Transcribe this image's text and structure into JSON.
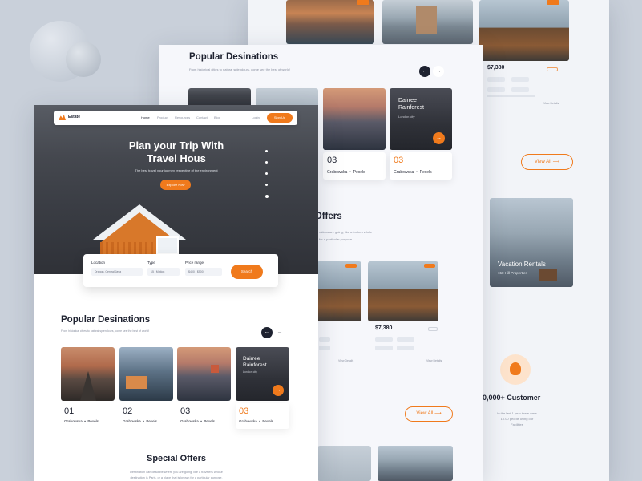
{
  "brand": {
    "name": "Estate"
  },
  "nav": {
    "items": [
      "Home",
      "Product",
      "Resources",
      "Contact",
      "Blog"
    ],
    "login": "Login",
    "signup": "Sign Up"
  },
  "hero": {
    "title_line1": "Plan your Trip With",
    "title_line2": "Travel Hous",
    "subtitle": "The best travel your journey respective of the environment",
    "cta": "Explore Now"
  },
  "search": {
    "location_label": "Location",
    "location_value": "Dragon, Central Java",
    "type_label": "Type",
    "type_value": "15 / Motion",
    "price_label": "Price range",
    "price_value": "$400 - $500",
    "button": "Search"
  },
  "popular": {
    "title": "Popular Desinations",
    "subtitle": "From historical cities to natural splendours, come see the best of world!",
    "cards": [
      {
        "num": "01",
        "author": "Grabowska",
        "source": "Pexels"
      },
      {
        "num": "02",
        "author": "Grabowska",
        "source": "Pexels"
      },
      {
        "num": "03",
        "author": "Grabowska",
        "source": "Pexels"
      },
      {
        "num": "03",
        "author": "Grabowska",
        "source": "Pexels"
      }
    ],
    "featured": {
      "title_line1": "Dairree",
      "title_line2": "Rainforest",
      "location": "London city"
    }
  },
  "mid": {
    "title": "Popular Desinations",
    "subtitle": "From historical cities to natural splendours, come see the best of world!",
    "cards": [
      {
        "num": "03",
        "author": "Grabowska",
        "source": "Pexels"
      },
      {
        "num": "03",
        "author": "Grabowska",
        "source": "Pexels"
      }
    ],
    "featured": {
      "title_line1": "Dairree",
      "title_line2": "Rainforest",
      "location": "London city"
    },
    "offers_title": "al Offers",
    "offers_text_1": "rations are going, like a broken whole",
    "offers_text_2": "for a particular purpose.",
    "price": "$7,380",
    "view_all": "View All",
    "view_details": "View Details"
  },
  "back": {
    "price": "$7,380",
    "view_all": "View All",
    "view_details": "View Details",
    "vacation_title": "Vacation Rentals",
    "vacation_sub": "150 Hill Properties",
    "customers_title": "0,000+ Customer",
    "customers_text_1": "In the last 1 year there were",
    "customers_text_2": "10.00 people using our",
    "customers_text_3": "Facilities"
  },
  "special": {
    "title": "Special Offers",
    "text_1": "Destination can describe where you are going, like a travelers whose",
    "text_2": "destination is Paris, or a place that is known for a particular purpose."
  }
}
